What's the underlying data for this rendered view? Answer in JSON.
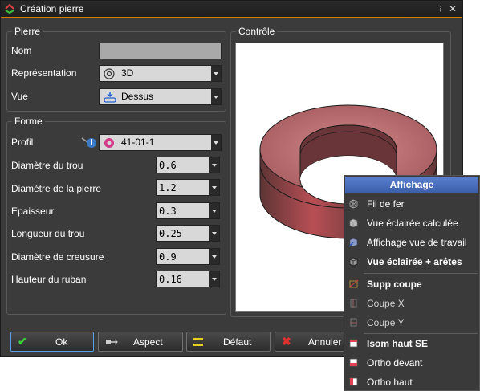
{
  "window": {
    "title": "Création pierre"
  },
  "pierre": {
    "title": "Pierre",
    "nom_label": "Nom",
    "nom_value": "",
    "representation_label": "Représentation",
    "representation_value": "3D",
    "vue_label": "Vue",
    "vue_value": "Dessus"
  },
  "forme": {
    "title": "Forme",
    "profil_label": "Profil",
    "profil_value": "41-01-1",
    "fields": [
      {
        "label": "Diamètre du trou",
        "value": "0.6"
      },
      {
        "label": "Diamètre de la pierre",
        "value": "1.2"
      },
      {
        "label": "Epaisseur",
        "value": "0.3"
      },
      {
        "label": "Longueur du trou",
        "value": "0.25"
      },
      {
        "label": "Diamètre de creusure",
        "value": "0.9"
      },
      {
        "label": "Hauteur du ruban",
        "value": "0.16"
      }
    ]
  },
  "controle": {
    "title": "Contrôle"
  },
  "buttons": {
    "ok": "Ok",
    "aspect": "Aspect",
    "defaut": "Défaut",
    "annuler": "Annuler"
  },
  "menu": {
    "header": "Affichage",
    "items": [
      "Fil de fer",
      "Vue éclairée calculée",
      "Affichage vue de travail",
      "Vue éclairée + arêtes",
      "Supp coupe",
      "Coupe X",
      "Coupe Y",
      "Isom haut SE",
      "Ortho devant",
      "Ortho haut"
    ]
  },
  "colors": {
    "accent": "#d97a00",
    "selection": "#4a6fc0",
    "dialog_bg": "#3b3b3b"
  }
}
